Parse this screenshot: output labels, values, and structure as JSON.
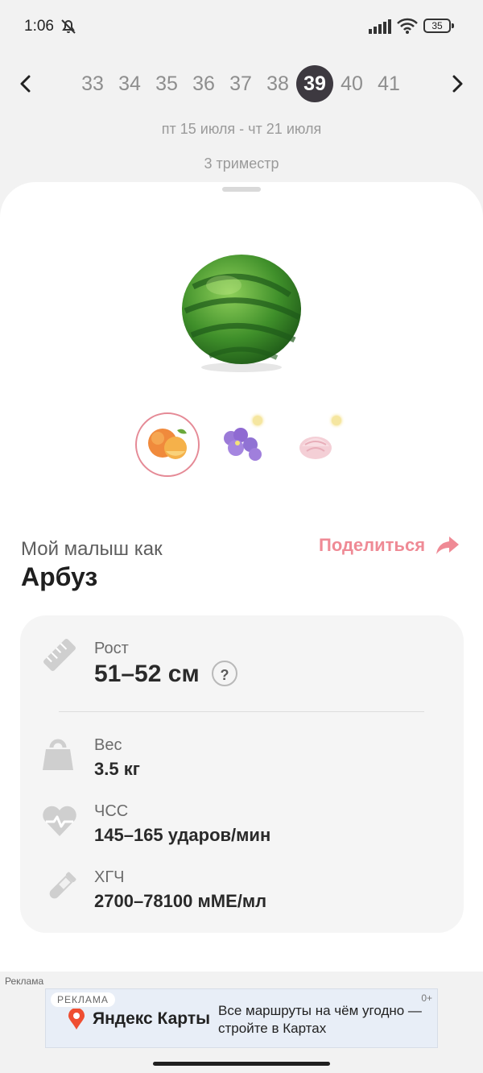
{
  "status_bar": {
    "time": "1:06",
    "battery": "35",
    "icons": [
      "mute-icon",
      "signal-icon",
      "wifi-icon",
      "battery-icon"
    ]
  },
  "week_nav": {
    "weeks": [
      "33",
      "34",
      "35",
      "36",
      "37",
      "38",
      "39",
      "40",
      "41"
    ],
    "selected_week": "39",
    "date_range": "пт 15 июля - чт 21 июля",
    "trimester": "3 триместр",
    "prev_icon": "chevron-left-icon",
    "next_icon": "chevron-right-icon"
  },
  "comparison": {
    "hero_icon": "watermelon-image",
    "thumbnails": [
      "peach-image",
      "violet-flower-image",
      "marshmallow-image"
    ],
    "lead": "Мой малыш как",
    "fruit": "Арбуз",
    "share_label": "Поделиться",
    "share_icon": "share-arrow-icon"
  },
  "metrics": {
    "height_label": "Рост",
    "height_value": "51–52 см",
    "help_symbol": "?",
    "weight_label": "Вес",
    "weight_value": "3.5 кг",
    "hr_label": "ЧСС",
    "hr_value": "145–165 ударов/мин",
    "hcg_label": "ХГЧ",
    "hcg_value": "2700–78100 мМЕ/мл"
  },
  "ad": {
    "label": "Реклама",
    "tag": "РЕКЛАМА",
    "age": "0+",
    "brand": "Яндекс Карты",
    "text": "Все маршруты на чём угодно — стройте в Картах"
  },
  "colors": {
    "accent": "#ef8a95",
    "active_week": "#3d3940",
    "card_bg": "#f5f5f5"
  }
}
